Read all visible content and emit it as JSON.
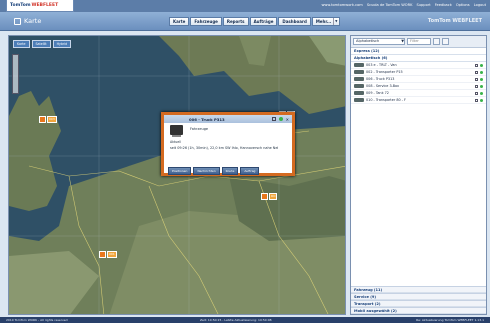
{
  "brand": {
    "part1": "TomTom",
    "part2": "WEBFLEET"
  },
  "top_links": [
    "www.tomtomwork.com",
    "Scuola de TomTom WORK",
    "Support",
    "Feedback",
    "Options",
    "Logout"
  ],
  "page_title": "Karte",
  "nav_tabs": [
    "Karte",
    "Fahrzeuge",
    "Reports",
    "Aufträge",
    "Dashboard"
  ],
  "nav_more": "Mehr...",
  "header_brand": "TomTom WEBFLEET",
  "map_buttons": [
    "Karte",
    "Satellit",
    "Hybrid"
  ],
  "map_markers": [
    {
      "id": "m1",
      "label": "003"
    },
    {
      "id": "m2",
      "label": "001"
    },
    {
      "id": "m3",
      "label": "FR"
    },
    {
      "id": "m4",
      "label": "RO"
    }
  ],
  "popup": {
    "title": "006 - Truck P313",
    "subtitle": "Fahrzeuge",
    "plate": "Aktuell",
    "detail": "seit 09:26 (1h, 30min), 22,0 km SW Ihlo, Hannoversch nahe Nel",
    "buttons": [
      "Positionen",
      "Nachrichten",
      "Route",
      "Auftrag"
    ]
  },
  "side": {
    "select_value": "Alphabetisch",
    "filter_placeholder": "Filter",
    "group_all": "Express (12)",
    "group_active": "Alphabetisch (6)",
    "vehicles": [
      {
        "name": "003 e - TRLT - Van"
      },
      {
        "name": "002 - Transporter P15"
      },
      {
        "name": "006 - Truck P313"
      },
      {
        "name": "008 - Service 3-Box"
      },
      {
        "name": "009 - Tank 72"
      },
      {
        "name": "010 - Transporter 80 - F"
      }
    ],
    "bottom_groups": [
      "Fahrzeug (11)",
      "Service (9)",
      "Transport (2)",
      "Mobil ausgewählt (2)"
    ]
  },
  "status": {
    "left": "2010 TomTom WORK - All rights reserved",
    "middle": "Zeit: 10:50:15  -  Letzte Aktualisierung: 10:50:08",
    "right": "Re: Aktualisierung  TomTom WEBFLEET 1.13.1"
  }
}
